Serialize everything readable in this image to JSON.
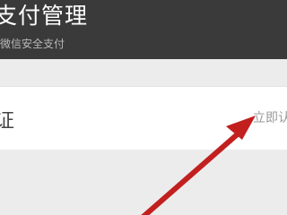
{
  "header": {
    "title": "支付管理",
    "subtitle": "微信安全支付"
  },
  "row": {
    "left_label": "证",
    "right_action": "立即认"
  },
  "annotation": {
    "icon": "red-arrow-icon",
    "color": "#c21f1f"
  }
}
